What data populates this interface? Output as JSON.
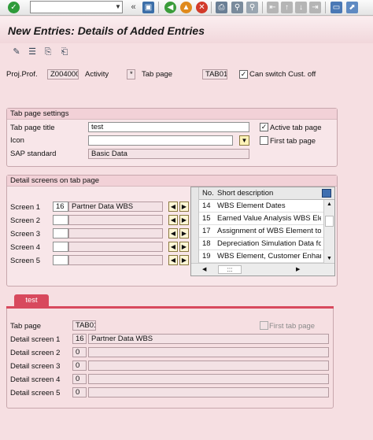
{
  "title": "New Entries: Details of Added Entries",
  "header": {
    "proj_prof_label": "Proj.Prof.",
    "proj_prof_value": "Z004000",
    "activity_label": "Activity",
    "activity_value": "*",
    "tab_page_label": "Tab page",
    "tab_page_value": "TAB01",
    "can_switch_label": "Can switch Cust. off",
    "can_switch_checked": true
  },
  "tab_settings": {
    "group_title": "Tab page settings",
    "title_label": "Tab page title",
    "title_value": "test",
    "icon_label": "Icon",
    "icon_value": "",
    "sap_standard_label": "SAP standard",
    "sap_standard_value": "Basic Data",
    "active_tab_label": "Active tab page",
    "active_tab_checked": true,
    "first_tab_label": "First tab page",
    "first_tab_checked": false
  },
  "detail_screens": {
    "group_title": "Detail screens on tab page",
    "rows": [
      {
        "label": "Screen 1",
        "number": "16",
        "description": "Partner Data WBS"
      },
      {
        "label": "Screen 2",
        "number": "",
        "description": ""
      },
      {
        "label": "Screen 3",
        "number": "",
        "description": ""
      },
      {
        "label": "Screen 4",
        "number": "",
        "description": ""
      },
      {
        "label": "Screen 5",
        "number": "",
        "description": ""
      }
    ],
    "table": {
      "col_no": "No.",
      "col_desc": "Short description",
      "rows": [
        {
          "no": "14",
          "desc": "WBS Element Dates"
        },
        {
          "no": "15",
          "desc": "Earned Value Analysis WBS Element"
        },
        {
          "no": "17",
          "desc": "Assignment of WBS Element to Pr"
        },
        {
          "no": "18",
          "desc": "Depreciation Simulation Data for"
        },
        {
          "no": "19",
          "desc": "WBS Element, Customer Enhance"
        }
      ],
      "scroll_text": ":::"
    }
  },
  "preview": {
    "tab_label": "test",
    "tab_page_label": "Tab page",
    "tab_page_value": "TAB01",
    "first_tab_label": "First tab page",
    "rows": [
      {
        "label": "Detail screen 1",
        "number": "16",
        "description": "Partner Data WBS"
      },
      {
        "label": "Detail screen 2",
        "number": "0",
        "description": ""
      },
      {
        "label": "Detail screen 3",
        "number": "0",
        "description": ""
      },
      {
        "label": "Detail screen 4",
        "number": "0",
        "description": ""
      },
      {
        "label": "Detail screen 5",
        "number": "0",
        "description": ""
      }
    ]
  },
  "icons": {
    "toolbar": [
      "enter-icon",
      "back-icon",
      "exit-icon",
      "cancel-icon",
      "print-icon",
      "find-icon",
      "find-next-icon",
      "first-page-icon",
      "prev-page-icon",
      "next-page-icon",
      "last-page-icon",
      "create-session-icon",
      "shortcut-icon"
    ],
    "app": [
      "glasses-icon",
      "select-all-icon",
      "copy-icon",
      "save-as-icon"
    ]
  },
  "colors": {
    "background": "#f6dfe2",
    "tab_active": "#d8495d",
    "lookup_button": "#fff3b8"
  }
}
